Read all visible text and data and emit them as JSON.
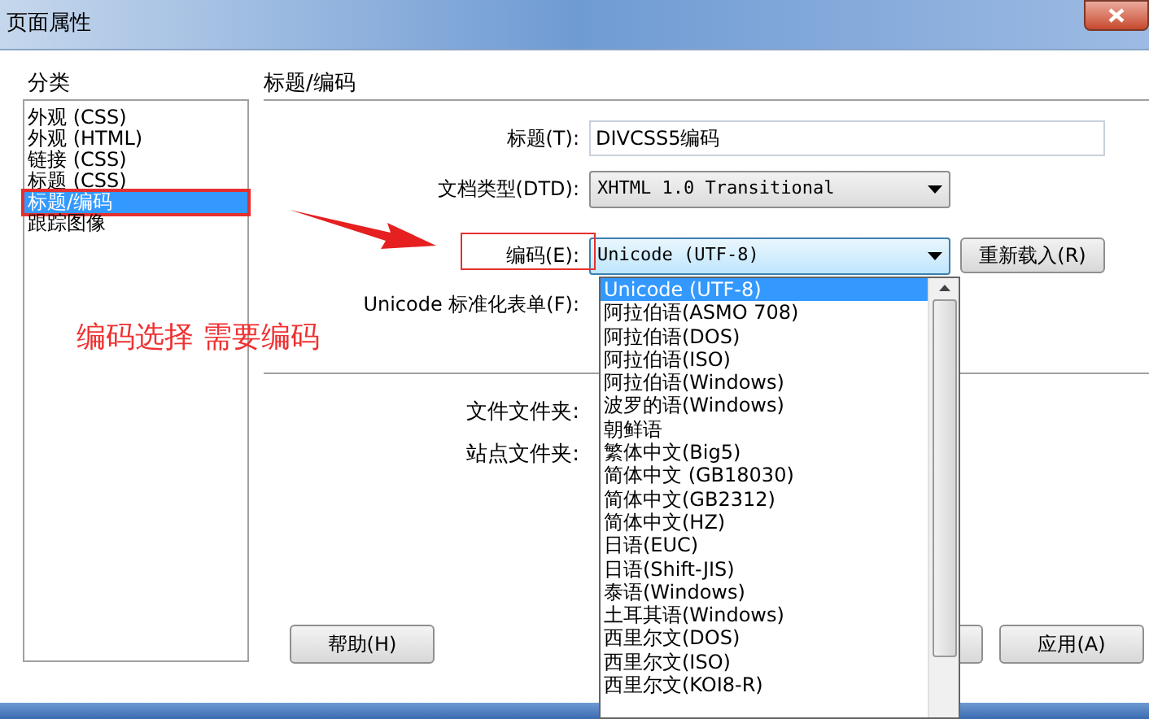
{
  "window": {
    "title": "页面属性"
  },
  "category": {
    "label": "分类",
    "items": [
      {
        "label": "外观 (CSS)",
        "selected": false
      },
      {
        "label": "外观 (HTML)",
        "selected": false
      },
      {
        "label": "链接 (CSS)",
        "selected": false
      },
      {
        "label": "标题 (CSS)",
        "selected": false
      },
      {
        "label": "标题/编码",
        "selected": true
      },
      {
        "label": "跟踪图像",
        "selected": false
      }
    ]
  },
  "panel": {
    "heading": "标题/编码",
    "fields": [
      {
        "kind": "text",
        "label": "标题(T):",
        "value": "DIVCSS5编码"
      },
      {
        "kind": "select",
        "label": "文档类型(DTD):",
        "value": "XHTML 1.0 Transitional",
        "expanded": false
      },
      {
        "kind": "select",
        "label": "编码(E):",
        "value": "Unicode (UTF-8)",
        "button": "重新载入(R)",
        "expanded": true
      },
      {
        "kind": "label",
        "label": "Unicode 标准化表单(F):"
      }
    ],
    "folders": [
      {
        "label": "文件文件夹:"
      },
      {
        "label": "站点文件夹:"
      }
    ]
  },
  "encoding_options": [
    {
      "label": "Unicode (UTF-8)",
      "selected": true
    },
    {
      "label": "阿拉伯语(ASMO 708)",
      "selected": false
    },
    {
      "label": "阿拉伯语(DOS)",
      "selected": false
    },
    {
      "label": "阿拉伯语(ISO)",
      "selected": false
    },
    {
      "label": "阿拉伯语(Windows)",
      "selected": false
    },
    {
      "label": "波罗的语(Windows)",
      "selected": false
    },
    {
      "label": "朝鲜语",
      "selected": false
    },
    {
      "label": "繁体中文(Big5)",
      "selected": false
    },
    {
      "label": "简体中文 (GB18030)",
      "selected": false
    },
    {
      "label": "简体中文(GB2312)",
      "selected": false
    },
    {
      "label": "简体中文(HZ)",
      "selected": false
    },
    {
      "label": "日语(EUC)",
      "selected": false
    },
    {
      "label": "日语(Shift-JIS)",
      "selected": false
    },
    {
      "label": "泰语(Windows)",
      "selected": false
    },
    {
      "label": "土耳其语(Windows)",
      "selected": false
    },
    {
      "label": "西里尔文(DOS)",
      "selected": false
    },
    {
      "label": "西里尔文(ISO)",
      "selected": false
    },
    {
      "label": "西里尔文(KOI8-R)",
      "selected": false
    }
  ],
  "buttons": [
    {
      "kind": "help",
      "label": "帮助(H)"
    },
    {
      "kind": "blank"
    },
    {
      "kind": "apply",
      "label": "应用(A)"
    }
  ],
  "annotation": {
    "text": "编码选择 需要编码"
  }
}
